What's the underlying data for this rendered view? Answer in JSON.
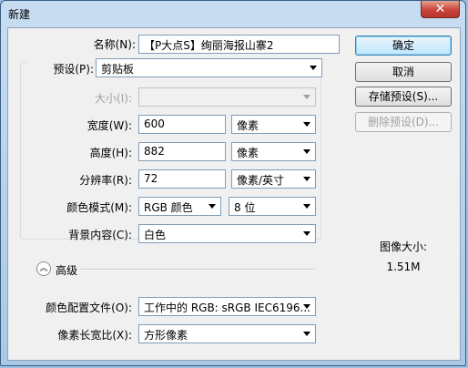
{
  "window": {
    "title": "新建",
    "close_label": "✕"
  },
  "form": {
    "name_label": "名称(N):",
    "name_value": "【P大点S】绚丽海报山寨2",
    "preset_label": "预设(P):",
    "preset_value": "剪贴板",
    "size_label": "大小(I):",
    "size_value": "",
    "width_label": "宽度(W):",
    "width_value": "600",
    "width_unit": "像素",
    "height_label": "高度(H):",
    "height_value": "882",
    "height_unit": "像素",
    "resolution_label": "分辨率(R):",
    "resolution_value": "72",
    "resolution_unit": "像素/英寸",
    "color_mode_label": "颜色模式(M):",
    "color_mode_value": "RGB 颜色",
    "bit_depth_value": "8 位",
    "background_label": "背景内容(C):",
    "background_value": "白色",
    "advanced_label": "高级",
    "advanced_icon": "chevron-up-double-icon",
    "color_profile_label": "颜色配置文件(O):",
    "color_profile_value": "工作中的 RGB: sRGB IEC6196...",
    "pixel_aspect_label": "像素长宽比(X):",
    "pixel_aspect_value": "方形像素"
  },
  "buttons": {
    "ok": "确定",
    "cancel": "取消",
    "save_preset": "存储预设(S)...",
    "delete_preset": "删除预设(D)..."
  },
  "image_size": {
    "label": "图像大小:",
    "value": "1.51M"
  }
}
